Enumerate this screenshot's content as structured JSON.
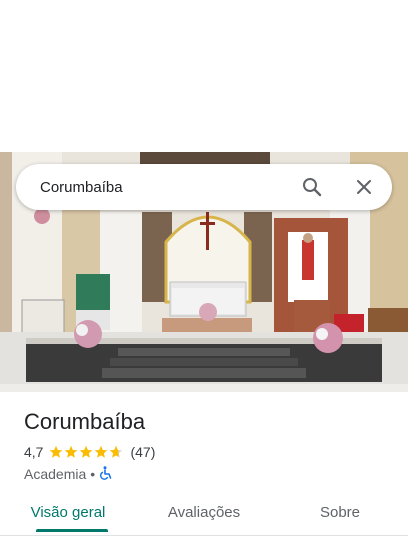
{
  "search": {
    "query": "Corumbaíba"
  },
  "place": {
    "name": "Corumbaíba",
    "rating": "4,7",
    "stars_filled": 4.7,
    "reviews": "(47)",
    "category": "Academia",
    "separator": "•"
  },
  "tabs": [
    {
      "label": "Visão geral",
      "active": true
    },
    {
      "label": "Avaliações",
      "active": false
    },
    {
      "label": "Sobre",
      "active": false
    }
  ],
  "colors": {
    "accent": "#00796b",
    "star": "#fbbc04",
    "accessible_icon": "#1a73e8"
  },
  "icons": [
    "search-icon",
    "close-icon",
    "wheelchair-icon",
    "star-icon"
  ]
}
